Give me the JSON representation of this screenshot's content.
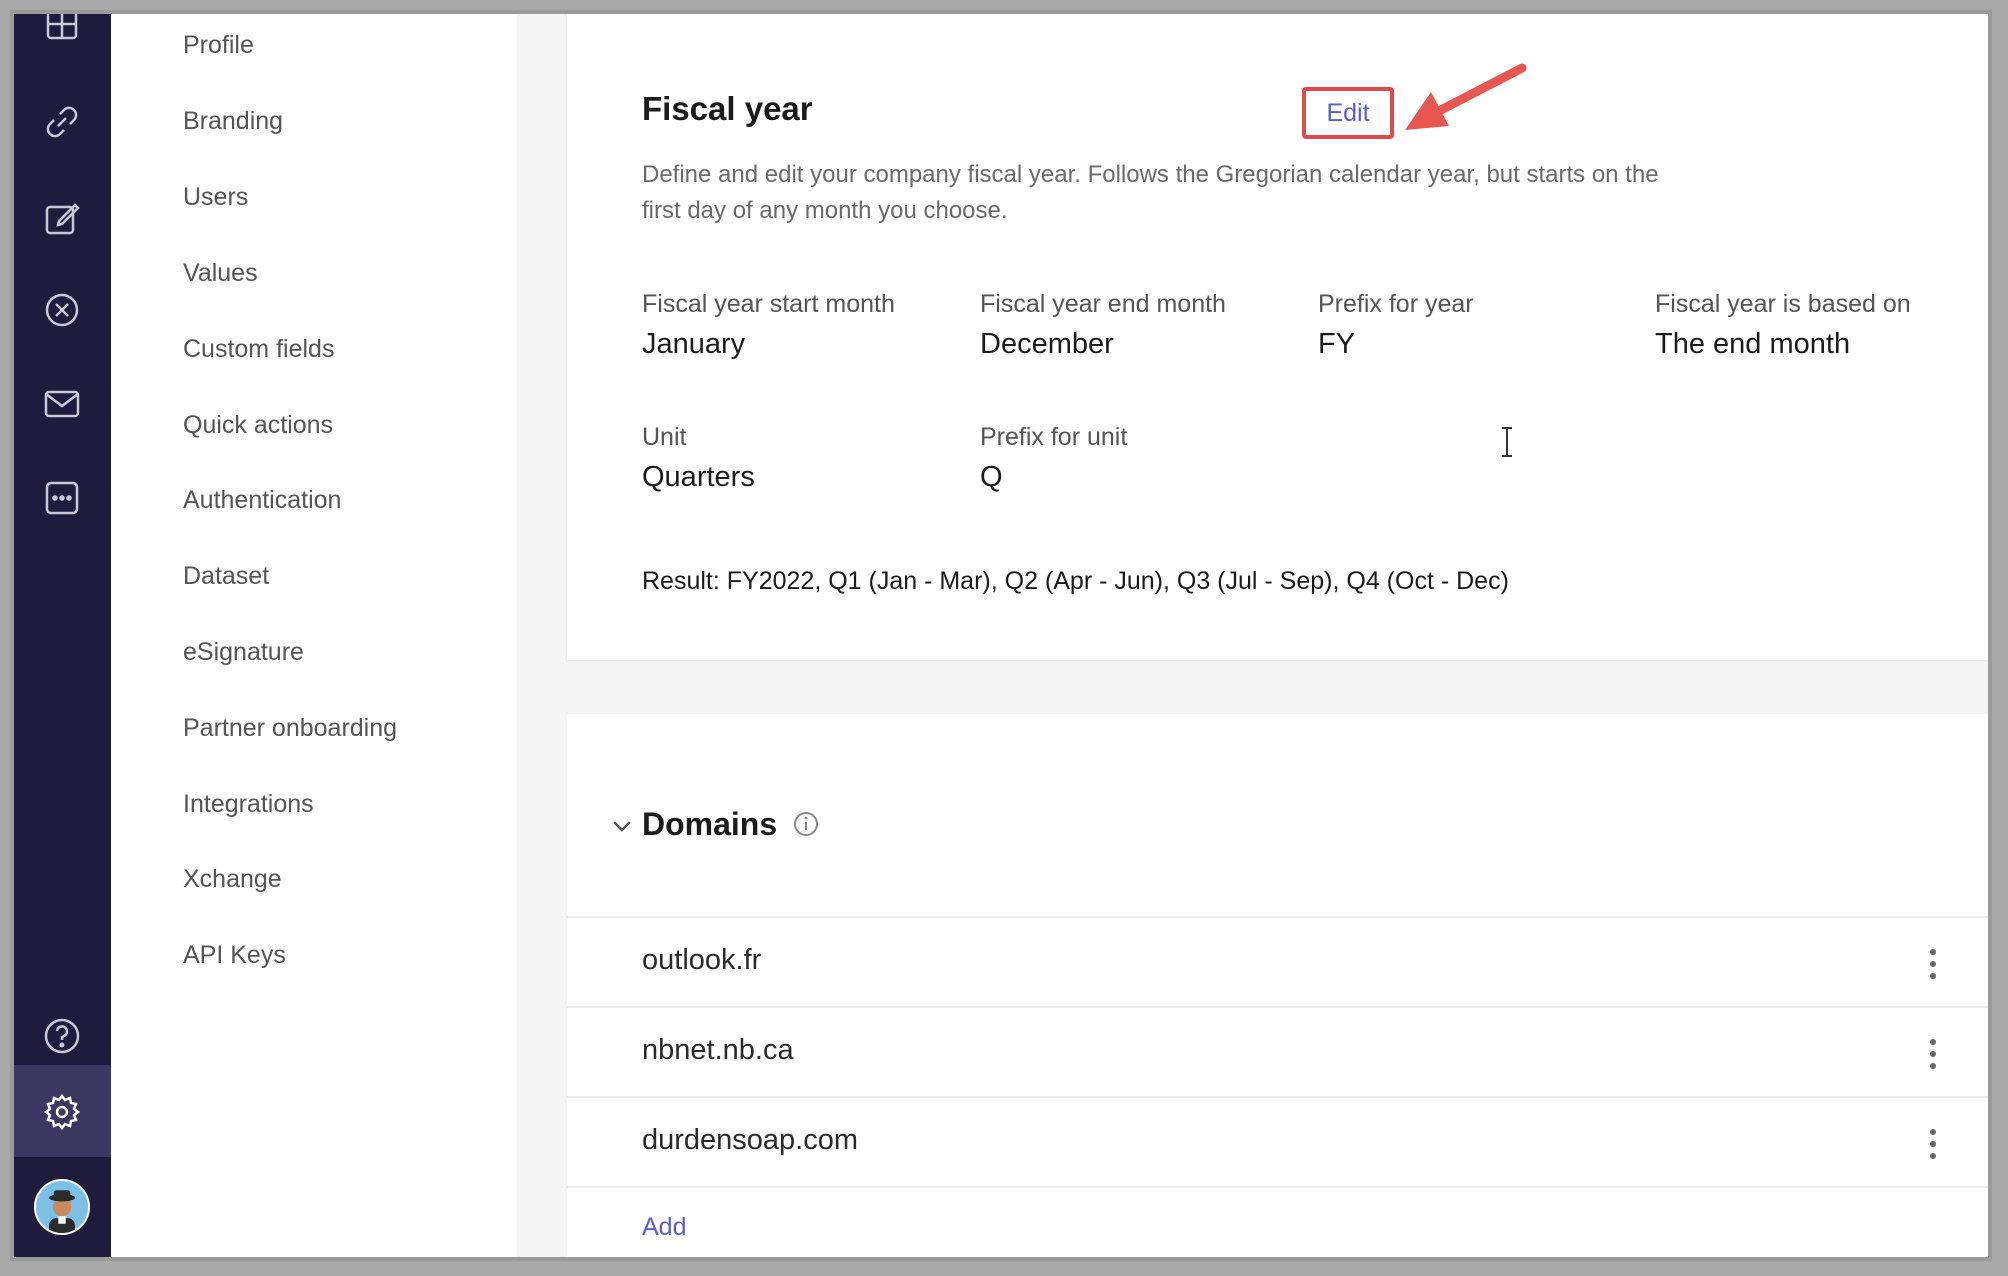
{
  "nav": {
    "items": [
      {
        "label": "Profile"
      },
      {
        "label": "Branding"
      },
      {
        "label": "Users"
      },
      {
        "label": "Values"
      },
      {
        "label": "Custom fields"
      },
      {
        "label": "Quick actions"
      },
      {
        "label": "Authentication"
      },
      {
        "label": "Dataset"
      },
      {
        "label": "eSignature"
      },
      {
        "label": "Partner onboarding"
      },
      {
        "label": "Integrations"
      },
      {
        "label": "Xchange"
      },
      {
        "label": "API Keys"
      }
    ]
  },
  "rail": {
    "icons": [
      "grid-icon",
      "link-icon",
      "edit-icon",
      "cancel-circle-icon",
      "mail-icon",
      "chat-dots-icon",
      "help-icon",
      "gear-icon"
    ],
    "active": "gear-icon"
  },
  "fiscal": {
    "title": "Fiscal year",
    "edit_label": "Edit",
    "description": "Define and edit your company fiscal year. Follows the Gregorian calendar year, but starts on the first day of any month you choose.",
    "fields": [
      {
        "label": "Fiscal year start month",
        "value": "January"
      },
      {
        "label": "Fiscal year end month",
        "value": "December"
      },
      {
        "label": "Prefix for year",
        "value": "FY"
      },
      {
        "label": "Fiscal year is based on",
        "value": "The end month"
      },
      {
        "label": "Unit",
        "value": "Quarters"
      },
      {
        "label": "Prefix for unit",
        "value": "Q"
      }
    ],
    "result": "Result: FY2022, Q1 (Jan - Mar), Q2 (Apr - Jun), Q3 (Jul - Sep), Q4 (Oct - Dec)"
  },
  "domains": {
    "title": "Domains",
    "items": [
      {
        "name": "outlook.fr"
      },
      {
        "name": "nbnet.nb.ca"
      },
      {
        "name": "durdensoap.com"
      }
    ],
    "add_label": "Add"
  },
  "colors": {
    "rail_bg": "#1f1b3d",
    "accent": "#5b5bd6",
    "highlight_box": "#e24a4a"
  }
}
